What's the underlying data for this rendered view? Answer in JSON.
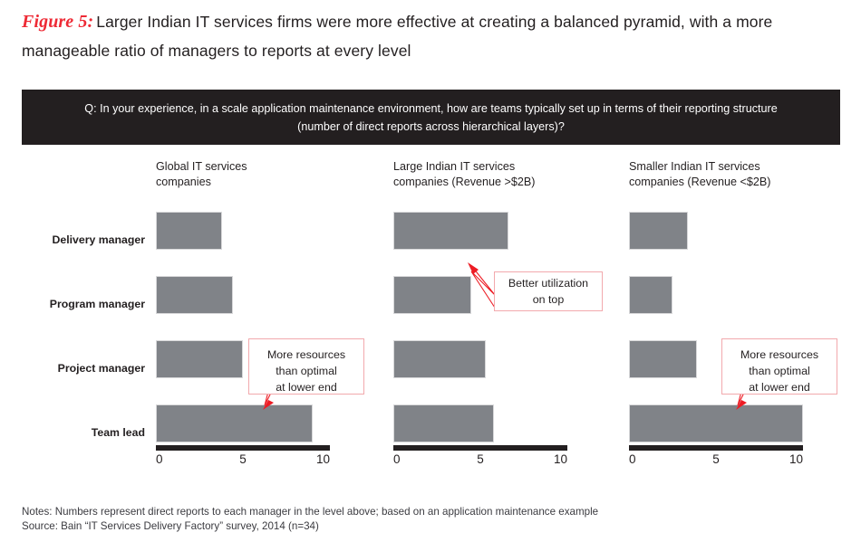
{
  "figure": {
    "label": "Figure 5:",
    "title": "Larger Indian IT services firms were more effective at creating a balanced pyramid, with a more manageable ratio of managers to reports at every level"
  },
  "question": {
    "text": "Q: In your experience, in a scale application maintenance environment, how are teams typically set up in terms of their reporting structure (number of direct reports across hierarchical layers)?"
  },
  "footnotes": {
    "notes": "Notes: Numbers represent direct reports to each manager in the level above; based on an application maintenance example",
    "source": "Source: Bain “IT Services Delivery Factory” survey, 2014 (n=34)"
  },
  "colors": {
    "bar_gray": "#808388",
    "accent_red": "#ee2a35",
    "callout_border": "#f2a9ad",
    "banner_black": "#231f20"
  },
  "row_labels": [
    "Delivery manager",
    "Program manager",
    "Project manager",
    "Team lead"
  ],
  "panels": [
    {
      "title_line1": "Global IT services",
      "title_line2": "companies"
    },
    {
      "title_line1": "Large Indian IT services",
      "title_line2": "companies (Revenue >$2B)"
    },
    {
      "title_line1": "Smaller Indian IT services",
      "title_line2": "companies (Revenue <$2B)"
    }
  ],
  "axis": {
    "ticks": [
      "0",
      "5",
      "10"
    ],
    "min": 0,
    "max": 10
  },
  "callouts": [
    {
      "line1": "More resources",
      "line2": "than optimal",
      "line3": "at lower end"
    },
    {
      "line1": "Better utilization",
      "line2": "on top",
      "line3": ""
    },
    {
      "line1": "More resources",
      "line2": "than optimal",
      "line3": "at lower end"
    }
  ],
  "chart_data": {
    "type": "bar",
    "orientation": "horizontal",
    "title": "Larger Indian IT services firms were more effective at creating a balanced pyramid, with a more manageable ratio of managers to reports at every level",
    "xlabel": "",
    "ylabel": "",
    "xlim": [
      0,
      10
    ],
    "xticks": [
      0,
      5,
      10
    ],
    "grid": false,
    "legend": "none",
    "categories": [
      "Delivery manager",
      "Program manager",
      "Project manager",
      "Team lead"
    ],
    "series": [
      {
        "name": "Global IT services companies",
        "values": [
          3.8,
          4.4,
          5.0,
          9.0
        ]
      },
      {
        "name": "Large Indian IT services companies (Revenue >$2B)",
        "values": [
          6.6,
          4.5,
          5.3,
          5.8
        ]
      },
      {
        "name": "Smaller Indian IT services companies (Revenue <$2B)",
        "values": [
          3.4,
          2.5,
          3.9,
          10.0
        ]
      }
    ],
    "annotations": [
      {
        "text": "More resources than optimal at lower end",
        "series": "Global IT services companies",
        "category": "Team lead"
      },
      {
        "text": "Better utilization on top",
        "series": "Large Indian IT services companies (Revenue >$2B)",
        "category": "Delivery manager"
      },
      {
        "text": "More resources than optimal at lower end",
        "series": "Smaller Indian IT services companies (Revenue <$2B)",
        "category": "Team lead"
      }
    ]
  }
}
